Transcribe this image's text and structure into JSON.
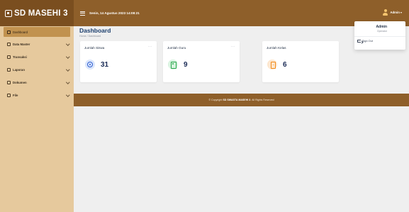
{
  "brand": {
    "title": "SD MASEHI 3"
  },
  "header": {
    "datetime": "Senin, 14 Agustus 2023 14:08:21",
    "user_name": "Admin",
    "user_caret": "▾"
  },
  "sidebar": {
    "items": [
      {
        "label": "Dashboard",
        "icon": "dashboard-icon",
        "active": true,
        "has_children": false
      },
      {
        "label": "Data Master",
        "icon": "database-icon",
        "active": false,
        "has_children": true
      },
      {
        "label": "Transaksi",
        "icon": "transaction-icon",
        "active": false,
        "has_children": true
      },
      {
        "label": "Laporan",
        "icon": "report-icon",
        "active": false,
        "has_children": true
      },
      {
        "label": "Dokumen",
        "icon": "document-icon",
        "active": false,
        "has_children": true
      },
      {
        "label": "File",
        "icon": "folder-icon",
        "active": false,
        "has_children": true
      }
    ]
  },
  "main": {
    "title": "Dashboard",
    "breadcrumb": "Home / Dashboard",
    "cards": [
      {
        "title": "Jumlah Siswa",
        "value": "31",
        "icon": "student-icon",
        "color": "#2f5fd2"
      },
      {
        "title": "Jumlah Guru",
        "value": "9",
        "icon": "teacher-badge-icon",
        "color": "#28a74b"
      },
      {
        "title": "Jumlah Kelas",
        "value": "6",
        "icon": "door-icon",
        "color": "#f28a18"
      }
    ],
    "card_menu": "···"
  },
  "footer": {
    "prefix": "© Copyright ",
    "brand": "SD SWASTA MASEHI 3",
    "suffix": ". All Rights Reserved"
  },
  "dropdown": {
    "name": "Admin",
    "role": "Operator",
    "signout": "Sign Out"
  },
  "colors": {
    "brand_dark": "#7a4e1f",
    "header": "#8e5f2a",
    "sidebar": "#e6c99d",
    "sidebar_active": "#c1924f",
    "page_bg": "#efefef",
    "title": "#1c3f6e"
  }
}
